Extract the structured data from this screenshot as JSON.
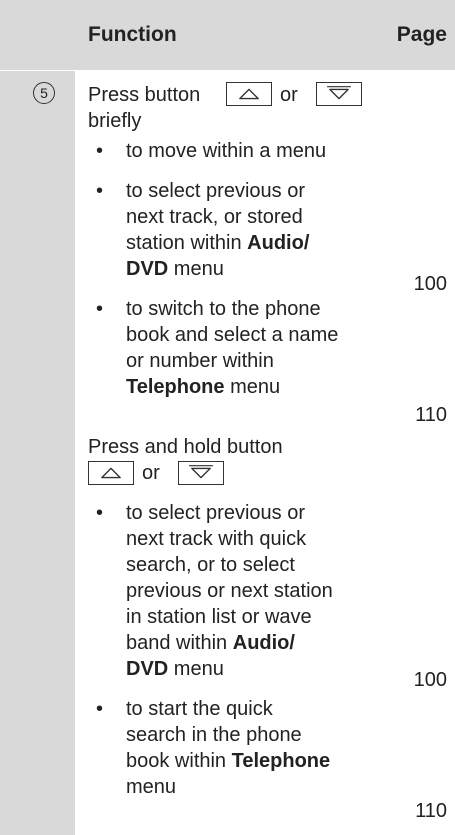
{
  "header": {
    "function_label": "Function",
    "page_label": "Page"
  },
  "row_number": "5",
  "section1": {
    "line1_prefix": "Press button",
    "or_word": "or",
    "line2": "briefly",
    "bullet_glyph": "•",
    "items": [
      {
        "lines": [
          "to move within a menu"
        ]
      },
      {
        "lines": [
          "to select previous or",
          "next track, or stored",
          "station within "
        ],
        "bold_a": "Audio/",
        "bold_b": "DVD",
        "tail": " menu",
        "page": "100"
      },
      {
        "lines": [
          "to switch to the phone",
          "book and select a name",
          "or number within"
        ],
        "bold": "Telephone",
        "tail": " menu",
        "page": "110"
      }
    ]
  },
  "section2": {
    "line1": "Press and hold button",
    "or_word": "or",
    "items": [
      {
        "lines": [
          "to select previous or",
          "next track with quick",
          "search, or to select",
          "previous or next station",
          "in station list or wave",
          "band within "
        ],
        "bold_a": "Audio/",
        "bold_b": "DVD",
        "tail": " menu",
        "page": "100"
      },
      {
        "lines": [
          "to start the quick",
          "search in the phone",
          "book within "
        ],
        "bold": "Telephone",
        "last": "menu",
        "page": "110"
      }
    ]
  },
  "icons": {
    "up_key": "up-arrow-key-icon",
    "down_key": "down-arrow-key-icon"
  }
}
